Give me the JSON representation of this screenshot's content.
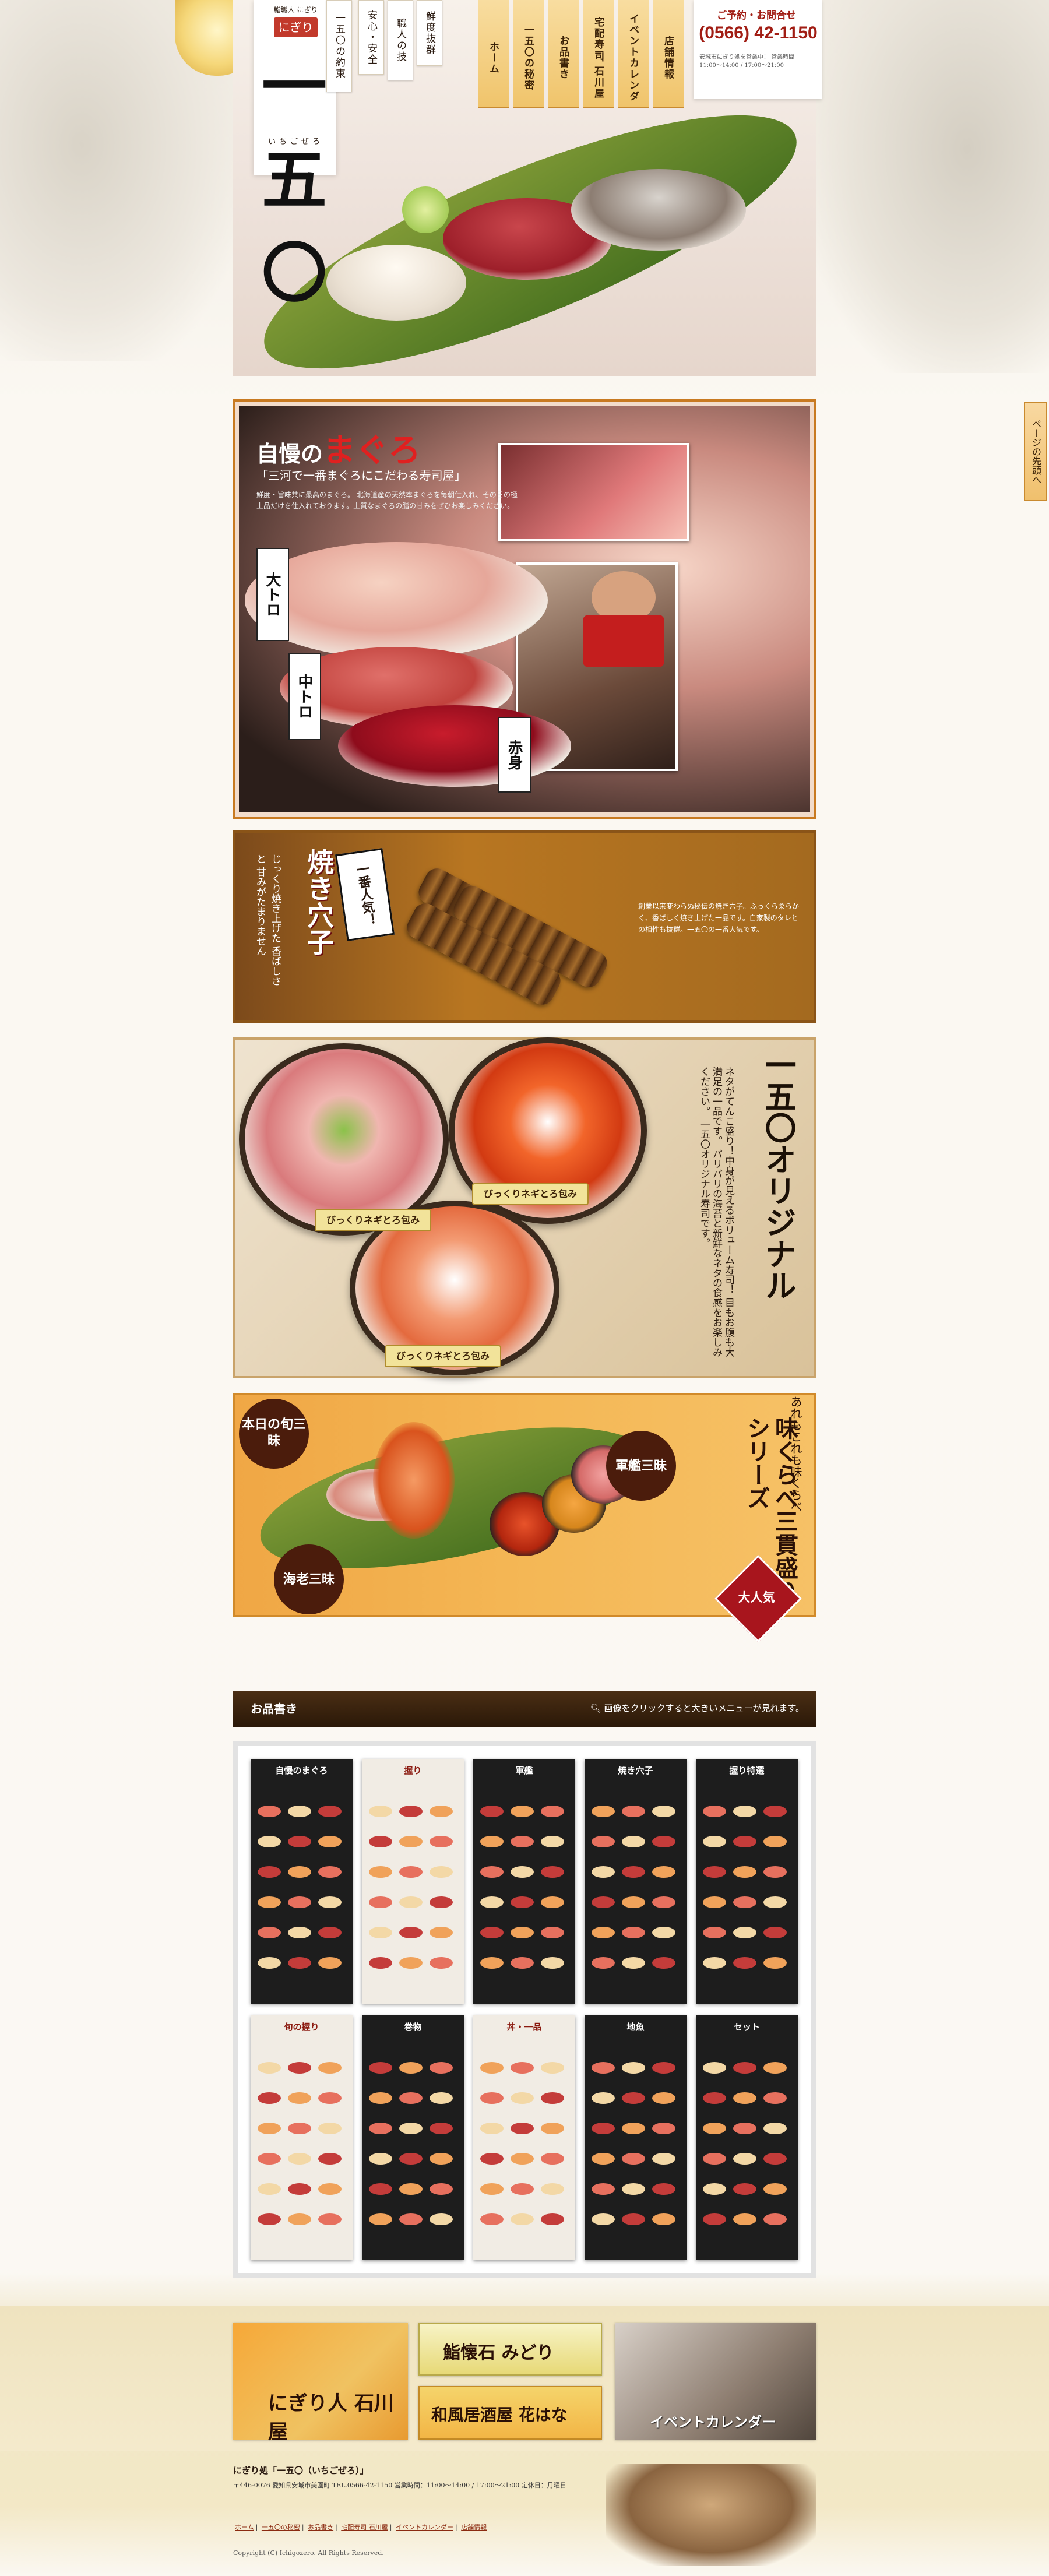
{
  "brand": {
    "small_label": "鮨職人 にぎり",
    "tag": "にぎり処",
    "name": "一五〇",
    "ruby": "いちごぜろ"
  },
  "vertical_tags": [
    "一五〇の約束",
    "安心・安全",
    "職人の技",
    "鮮度抜群"
  ],
  "nav": {
    "items": [
      {
        "label": "ホーム"
      },
      {
        "label": "一五〇の秘密"
      },
      {
        "label": "お品書き"
      },
      {
        "label": "宅配寿司 石川屋"
      },
      {
        "label": "イベントカレンダー"
      },
      {
        "label": "店舗情報"
      }
    ]
  },
  "contact": {
    "label": "ご予約・お問合せ",
    "phone": "(0566) 42-1150",
    "notes": "安城市にぎり処を営業中！ 営業時間 11:00〜14:00 / 17:00〜21:00"
  },
  "tuna": {
    "title_pre": "自慢の",
    "title_main": "まぐろ",
    "subtitle": "「三河で一番まぐろにこだわる寿司屋」",
    "desc": "鮮度・旨味共に最高のまぐろ。 北海道産の天然本まぐろを毎朝仕入れ、その日の極上品だけを仕入れております。上質なまぐろの脂の甘みをぜひお楽しみください。",
    "labels": [
      "大トロ",
      "中トロ",
      "赤身"
    ]
  },
  "anago": {
    "badge": "一番人気！",
    "title": "焼き穴子",
    "side": "じっくり焼き上げた 香ばしさと 甘みがたまりません",
    "desc": "創業以来変わらぬ秘伝の焼き穴子。ふっくら柔らかく、香ばしく焼き上げた一品です。自家製のタレとの相性も抜群。一五〇の一番人気です。"
  },
  "original": {
    "title": "一五〇オリジナル",
    "text": "ネタがてんこ盛り！中身が見えるボリューム寿司！ 目もお腹も大満足の一品です。 パリパリの海苔と新鮮なネタの食感をお楽しみください。 一五〇オリジナル寿司です。",
    "bowls": [
      "びっくりネギとろ包み",
      "びっくりネギとろ包み",
      "びっくりネギとろ包み"
    ]
  },
  "sanmai": {
    "top": "あれもこれも味くらべ",
    "title": "味くらべ三貫盛りシリーズ",
    "badge": "大人気",
    "circles": [
      "本日の旬三昧",
      "軍艦三昧",
      "海老三昧"
    ]
  },
  "menu_bar": {
    "title": "お品書き",
    "hint": "画像をクリックすると大きいメニューが見れます。"
  },
  "menu_thumbs": [
    {
      "title": "自慢のまぐろ",
      "color": "#1d1d1d"
    },
    {
      "title": "握り",
      "color": "#f1ece4"
    },
    {
      "title": "軍艦",
      "color": "#1d1d1d"
    },
    {
      "title": "焼き穴子",
      "color": "#1d1d1d"
    },
    {
      "title": "握り特選",
      "color": "#1d1d1d"
    },
    {
      "title": "旬の握り",
      "color": "#f1ece4"
    },
    {
      "title": "巻物",
      "color": "#1d1d1d"
    },
    {
      "title": "丼・一品",
      "color": "#f1ece4"
    },
    {
      "title": "地魚",
      "color": "#1d1d1d"
    },
    {
      "title": "セット",
      "color": "#1d1d1d"
    }
  ],
  "footer": {
    "ishikawa": "にぎり人 石川屋",
    "midori": "鮨懐石 みどり",
    "hana": "和風居酒屋 花はな",
    "event": "イベントカレンダー",
    "info_title": "にぎり処「一五〇（いちごぜろ）」",
    "address": "〒446-0076 愛知県安城市美園町 TEL.0566-42-1150 営業時間：11:00〜14:00 / 17:00〜21:00 定休日：月曜日",
    "links": [
      "ホーム",
      "一五〇の秘密",
      "お品書き",
      "宅配寿司 石川屋",
      "イベントカレンダー",
      "店舗情報"
    ],
    "copyright": "Copyright (C) Ichigozero. All Rights Reserved."
  },
  "pagetop": "ページの先頭へ"
}
